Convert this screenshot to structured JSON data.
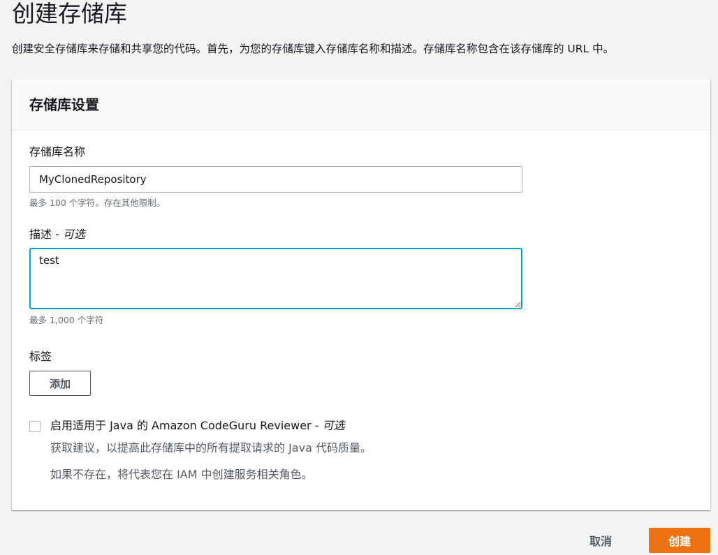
{
  "page": {
    "title": "创建存储库",
    "description": "创建安全存储库来存储和共享您的代码。首先，为您的存储库键入存储库名称和描述。存储库名称包含在该存储库的 URL 中。"
  },
  "settings": {
    "header": "存储库设置",
    "name_field": {
      "label": "存储库名称",
      "value": "MyClonedRepository",
      "hint": "最多 100 个字符。存在其他限制。"
    },
    "description_field": {
      "label": "描述 - ",
      "optional": "可选",
      "value": "test",
      "hint": "最多 1,000 个字符"
    },
    "tags": {
      "label": "标签",
      "add_button": "添加"
    },
    "codeguru": {
      "label": "启用适用于 Java 的 Amazon CodeGuru Reviewer - ",
      "optional": "可选",
      "checked": false,
      "desc1": "获取建议，以提高此存储库中的所有提取请求的 Java 代码质量。",
      "desc2": "如果不存在，将代表您在 IAM 中创建服务相关角色。"
    }
  },
  "actions": {
    "cancel": "取消",
    "create": "创建"
  },
  "colors": {
    "primary_button": "#ec7211",
    "focus_border": "#00a1c9",
    "background": "#f2f3f3"
  }
}
